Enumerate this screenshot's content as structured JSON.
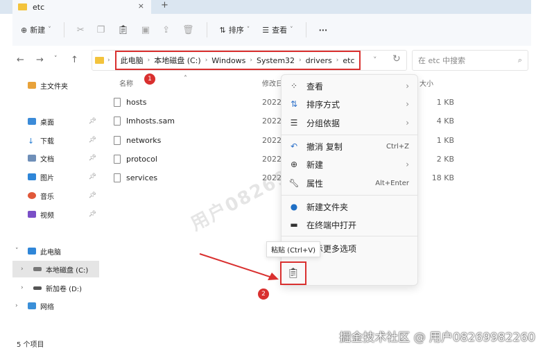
{
  "tab": {
    "title": "etc",
    "close": "×",
    "new": "+"
  },
  "toolbar": {
    "new": "新建",
    "sort": "排序",
    "view": "查看",
    "more": "···"
  },
  "breadcrumb": [
    "此电脑",
    "本地磁盘 (C:)",
    "Windows",
    "System32",
    "drivers",
    "etc"
  ],
  "search": {
    "placeholder": "在 etc 中搜索"
  },
  "sidebar": {
    "home": "主文件夹",
    "desktop": "桌面",
    "downloads": "下载",
    "documents": "文档",
    "pictures": "图片",
    "music": "音乐",
    "videos": "视频",
    "thispc": "此电脑",
    "cdrive": "本地磁盘 (C:)",
    "ddrive": "新加卷 (D:)",
    "network": "网络"
  },
  "columns": {
    "name": "名称",
    "modified": "修改日",
    "size": "大小"
  },
  "files": [
    {
      "name": "hosts",
      "date": "2022/",
      "size": "1 KB"
    },
    {
      "name": "lmhosts.sam",
      "date": "2022/",
      "size": "4 KB"
    },
    {
      "name": "networks",
      "date": "2022/",
      "size": "1 KB"
    },
    {
      "name": "protocol",
      "date": "2022/",
      "size": "2 KB"
    },
    {
      "name": "services",
      "date": "2022/",
      "size": "18 KB"
    }
  ],
  "menu": {
    "view": "查看",
    "sort": "排序方式",
    "group": "分组依据",
    "undo": "撤消 复制",
    "undo_sc": "Ctrl+Z",
    "new": "新建",
    "props": "属性",
    "props_sc": "Alt+Enter",
    "newfolder": "新建文件夹",
    "terminal": "在终端中打开",
    "more": "显示更多选项"
  },
  "tooltip": "粘贴 (Ctrl+V)",
  "badges": [
    "1",
    "2"
  ],
  "status": "5 个项目",
  "watermark": "掘金技术社区 @ 用户08269982260",
  "diag_watermark": "用户08269982260"
}
